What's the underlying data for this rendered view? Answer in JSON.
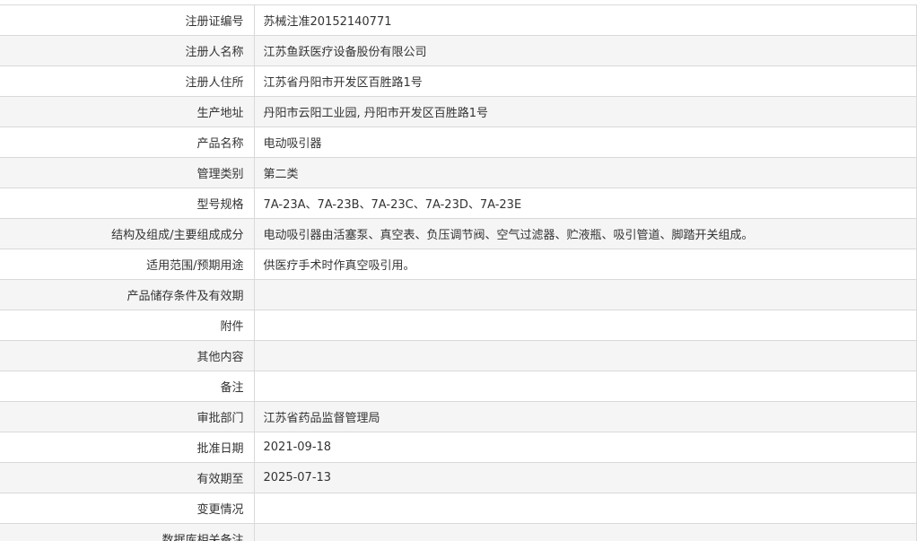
{
  "record": {
    "rows": [
      {
        "label": "注册证编号",
        "value": "苏械注准20152140771"
      },
      {
        "label": "注册人名称",
        "value": "江苏鱼跃医疗设备股份有限公司"
      },
      {
        "label": "注册人住所",
        "value": "江苏省丹阳市开发区百胜路1号"
      },
      {
        "label": "生产地址",
        "value": "丹阳市云阳工业园, 丹阳市开发区百胜路1号"
      },
      {
        "label": "产品名称",
        "value": "电动吸引器"
      },
      {
        "label": "管理类别",
        "value": "第二类"
      },
      {
        "label": "型号规格",
        "value": "7A-23A、7A-23B、7A-23C、7A-23D、7A-23E"
      },
      {
        "label": "结构及组成/主要组成成分",
        "value": "电动吸引器由活塞泵、真空表、负压调节阀、空气过滤器、贮液瓶、吸引管道、脚踏开关组成。"
      },
      {
        "label": "适用范围/预期用途",
        "value": "供医疗手术时作真空吸引用。"
      },
      {
        "label": "产品储存条件及有效期",
        "value": ""
      },
      {
        "label": "附件",
        "value": ""
      },
      {
        "label": "其他内容",
        "value": ""
      },
      {
        "label": "备注",
        "value": ""
      },
      {
        "label": "审批部门",
        "value": "江苏省药品监督管理局"
      },
      {
        "label": "批准日期",
        "value": "2021-09-18"
      },
      {
        "label": "有效期至",
        "value": "2025-07-13"
      },
      {
        "label": "变更情况",
        "value": ""
      },
      {
        "label": "数据库相关备注",
        "value": ""
      }
    ]
  }
}
